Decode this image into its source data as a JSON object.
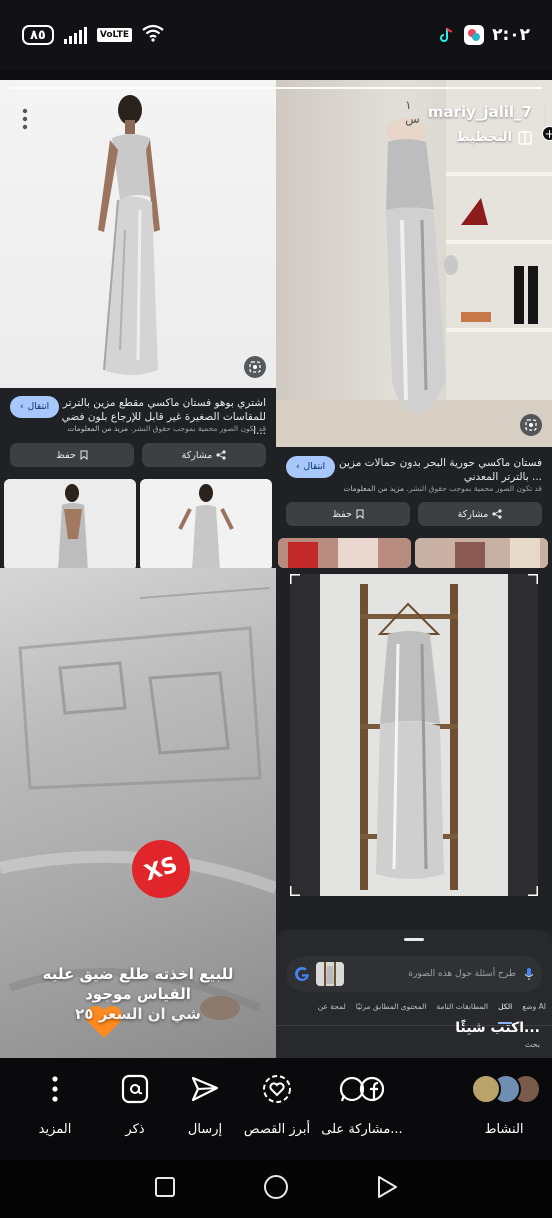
{
  "status_bar": {
    "battery": "٨٥",
    "network": "VoLTE",
    "time": "٢:٠٢"
  },
  "story": {
    "username": "mariy_jalil_7",
    "time_ago": "١ س",
    "plan_label": "التخطيط"
  },
  "lens_left": {
    "caption": "اشتري بوهو فستان ماكسي مقطع مزين بالترتر للمقاسات الصغيرة غير قابل للإرجاع بلون فضي ا...",
    "copyright": "قد تكون الصور محمية بموجب حقوق النشر.",
    "more_info": "مزيد من المعلومات",
    "visit_label": "انتقال",
    "share_label": "مشاركة",
    "save_label": "حفظ"
  },
  "lens_right": {
    "caption": "فستان ماكسي حورية البحر بدون حمالات مزين بالترتر المعدني ...",
    "copyright": "قد تكون الصور محمية بموجب حقوق النشر.",
    "more_info": "مزيد من المعلومات",
    "visit_label": "انتقال",
    "share_label": "مشاركة",
    "save_label": "حفظ"
  },
  "sale_post": {
    "line1": "للبيع اخذته طلع ضيق عليه",
    "line2": "القياس موجود",
    "line3": "شي ان السعر ٢٥",
    "sticker": "XS"
  },
  "lens_search": {
    "placeholder": "طرح أسئلة حول هذه الصورة",
    "tabs": [
      "وضع AI",
      "الكل",
      "المطابقات التامة",
      "المحتوى المطابق مرئيًا",
      "لمحة عن"
    ],
    "active_tab": "الكل",
    "typing": "اكتب شيئًا...",
    "search_hint": "بحث"
  },
  "actions": {
    "activity": "النشاط",
    "share_on": "مشاركة على...",
    "highlight": "أبرز القصص",
    "send": "إرسال",
    "mention": "ذكر",
    "more": "المزيد"
  }
}
